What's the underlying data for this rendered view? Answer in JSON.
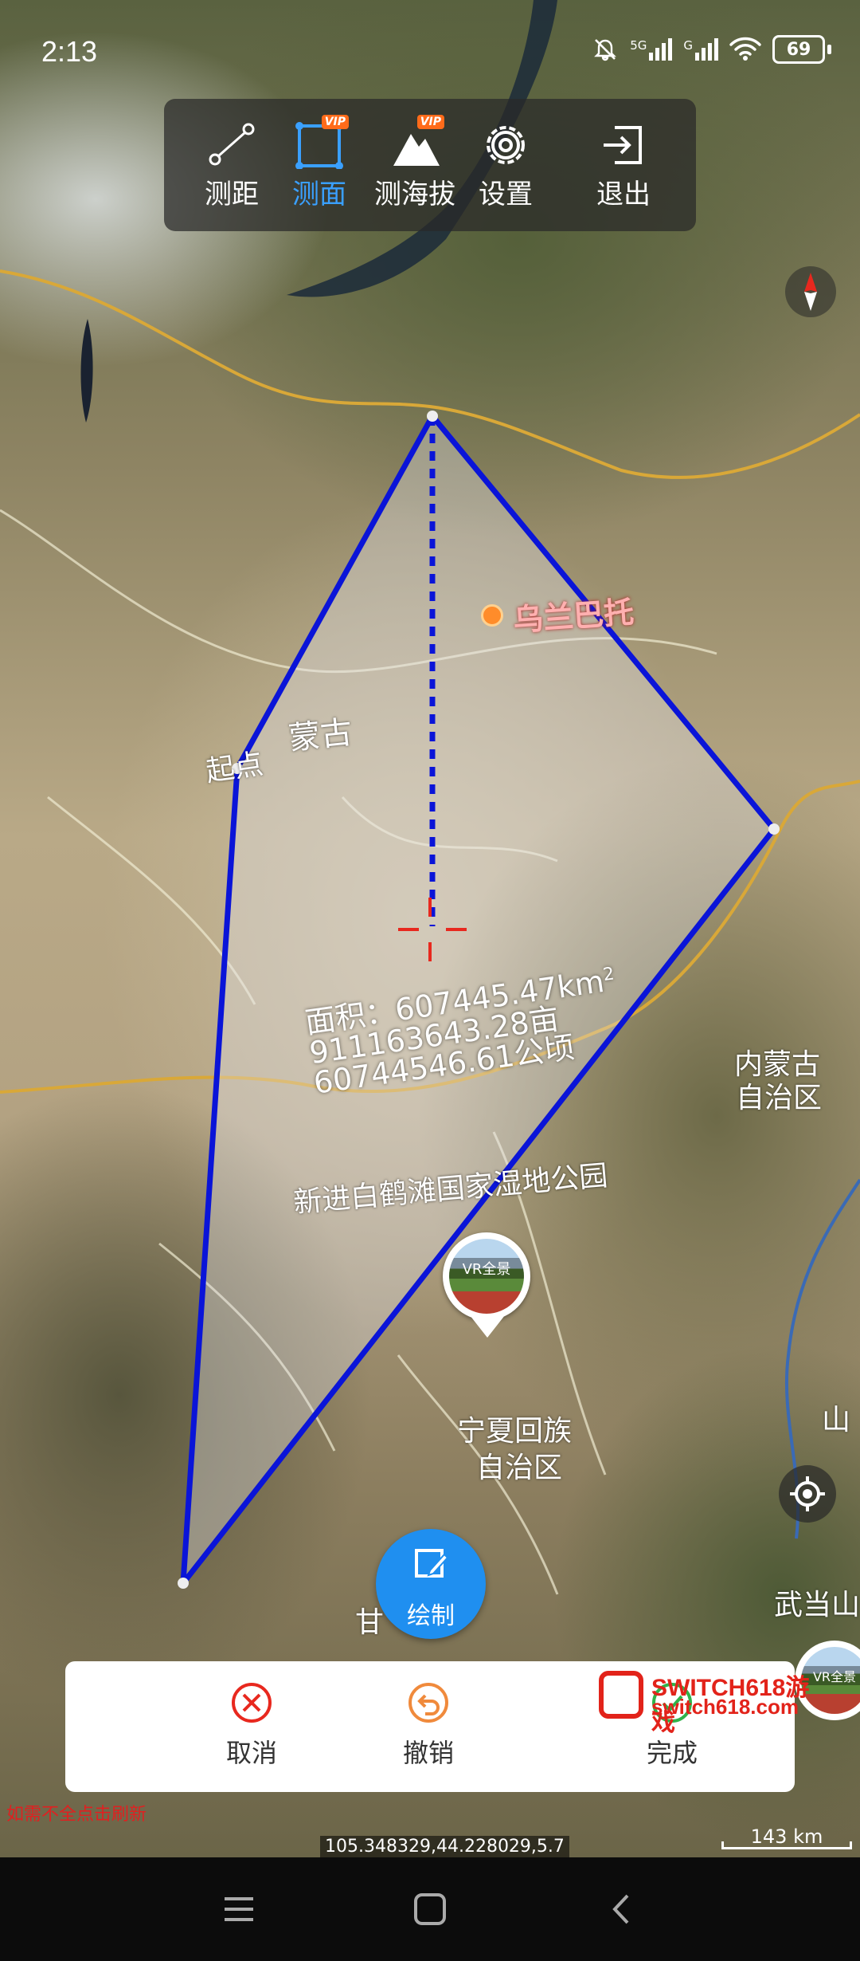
{
  "status_bar": {
    "time": "2:13",
    "network_1": "5G",
    "network_2": "G",
    "battery": "69"
  },
  "toolbar": {
    "items": [
      {
        "label": "测距",
        "icon": "ruler-line-icon",
        "vip": false,
        "active": false
      },
      {
        "label": "测面",
        "icon": "area-square-icon",
        "vip": true,
        "active": true
      },
      {
        "label": "测海拔",
        "icon": "mountain-icon",
        "vip": true,
        "active": false
      },
      {
        "label": "设置",
        "icon": "gear-icon",
        "vip": false,
        "active": false
      },
      {
        "label": "退出",
        "icon": "exit-icon",
        "vip": false,
        "active": false
      }
    ],
    "vip_badge": "VIP"
  },
  "map": {
    "labels": {
      "city_wulanbatuo": "乌兰巴托",
      "mongolia": "蒙古",
      "start_point": "起点",
      "inner_mongolia_1": "内蒙古",
      "inner_mongolia_2": "自治区",
      "park": "新进白鹤滩国家湿地公园",
      "ningxia_1": "宁夏回族",
      "ningxia_2": "自治区",
      "wudang": "武当山",
      "shan": "山",
      "gan": "甘"
    },
    "measurement": {
      "area_line1": "面积：607445.47km",
      "area_unit_sup": "2",
      "area_line2": "911163643.28亩",
      "area_line3": "60744546.61公顷"
    },
    "vr_label": "VR全景",
    "colors": {
      "polygon_stroke": "#0a14d8",
      "crosshair": "#e8281e"
    }
  },
  "draw_button": {
    "label": "绘制"
  },
  "actions": {
    "cancel": "取消",
    "undo": "撤销",
    "done": "完成"
  },
  "watermark": {
    "line1": "SWITCH618游戏",
    "line2": "switch618.com"
  },
  "footer": {
    "notice": "如需不全点击刷新",
    "coordinates": "105.348329,44.228029,5.7",
    "scale": "143 km"
  },
  "nav_bar": {
    "items": [
      "menu-icon",
      "home-icon",
      "back-icon"
    ]
  }
}
